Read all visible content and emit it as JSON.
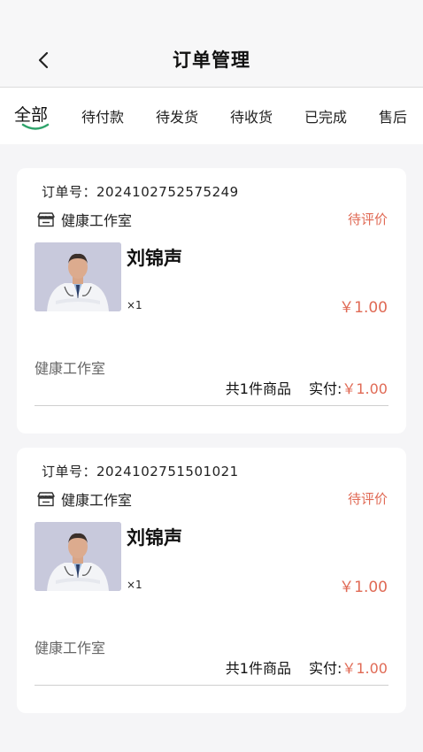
{
  "header": {
    "title": "订单管理",
    "back_icon": "chevron-left-icon"
  },
  "tabs": [
    {
      "label": "全部",
      "active": true
    },
    {
      "label": "待付款",
      "active": false
    },
    {
      "label": "待发货",
      "active": false
    },
    {
      "label": "待收货",
      "active": false
    },
    {
      "label": "已完成",
      "active": false
    },
    {
      "label": "售后",
      "active": false
    }
  ],
  "colors": {
    "accent_price": "#e06a55",
    "tab_underline": "#2fa36b"
  },
  "orders": [
    {
      "order_no_label": "订单号：2024102752575249",
      "store_icon": "store-icon",
      "store_name": "健康工作室",
      "status": "待评价",
      "product_image": "doctor-photo",
      "product_name": "刘锦声",
      "quantity": "×1",
      "unit_price": "￥1.00",
      "footer_store": "健康工作室",
      "item_count": "共1件商品",
      "paid_label": "实付:",
      "paid_amount": "￥1.00"
    },
    {
      "order_no_label": "订单号：2024102751501021",
      "store_icon": "store-icon",
      "store_name": "健康工作室",
      "status": "待评价",
      "product_image": "doctor-photo",
      "product_name": "刘锦声",
      "quantity": "×1",
      "unit_price": "￥1.00",
      "footer_store": "健康工作室",
      "item_count": "共1件商品",
      "paid_label": "实付:",
      "paid_amount": "￥1.00"
    }
  ]
}
